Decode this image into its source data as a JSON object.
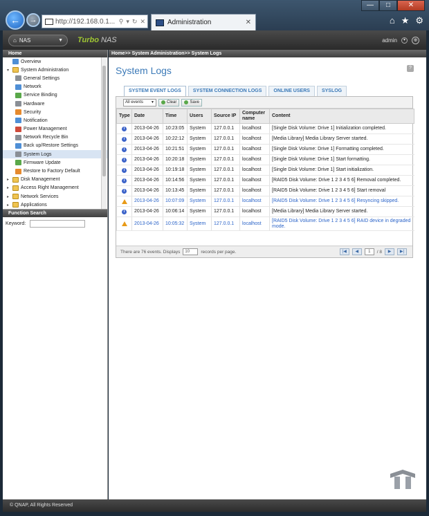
{
  "browser": {
    "address": "http://192.168.0.1...",
    "tab_title": "Administration",
    "window_buttons": [
      "—",
      "□",
      "✕"
    ],
    "tool_icons": [
      "home-icon",
      "star-icon",
      "gear-icon"
    ]
  },
  "header": {
    "nas_label": "NAS",
    "brand_prefix": "Turbo",
    "brand_suffix": "NAS",
    "user": "admin"
  },
  "sidebar": {
    "header": "Home",
    "items": [
      {
        "label": "Overview",
        "level": 0,
        "icon": "blue"
      },
      {
        "label": "System Administration",
        "level": 0,
        "icon": "folder",
        "toggle": "▾"
      },
      {
        "label": "General Settings",
        "level": 1,
        "icon": "gray"
      },
      {
        "label": "Network",
        "level": 1,
        "icon": "blue"
      },
      {
        "label": "Service Binding",
        "level": 1,
        "icon": "green"
      },
      {
        "label": "Hardware",
        "level": 1,
        "icon": "gray"
      },
      {
        "label": "Security",
        "level": 1,
        "icon": "orange"
      },
      {
        "label": "Notification",
        "level": 1,
        "icon": "blue"
      },
      {
        "label": "Power Management",
        "level": 1,
        "icon": "red"
      },
      {
        "label": "Network Recycle Bin",
        "level": 1,
        "icon": "gray"
      },
      {
        "label": "Back up/Restore Settings",
        "level": 1,
        "icon": "blue"
      },
      {
        "label": "System Logs",
        "level": 1,
        "icon": "gray",
        "selected": true
      },
      {
        "label": "Firmware Update",
        "level": 1,
        "icon": "green"
      },
      {
        "label": "Restore to Factory Default",
        "level": 1,
        "icon": "orange"
      },
      {
        "label": "Disk Management",
        "level": 0,
        "icon": "folder",
        "toggle": "▸"
      },
      {
        "label": "Access Right Management",
        "level": 0,
        "icon": "folder",
        "toggle": "▸"
      },
      {
        "label": "Network Services",
        "level": 0,
        "icon": "folder",
        "toggle": "▸"
      },
      {
        "label": "Applications",
        "level": 0,
        "icon": "folder",
        "toggle": "▸"
      }
    ],
    "function_search_title": "Function Search",
    "keyword_label": "Keyword:"
  },
  "main": {
    "breadcrumb": "Home>> System Administration>> System Logs",
    "title": "System Logs",
    "help_label": "?",
    "tabs": [
      "SYSTEM EVENT LOGS",
      "SYSTEM CONNECTION LOGS",
      "ONLINE USERS",
      "SYSLOG"
    ],
    "filter_value": "All events",
    "clear_label": "Clear",
    "save_label": "Save",
    "columns": [
      "Type",
      "Date",
      "Time",
      "Users",
      "Source IP",
      "Computer name",
      "Content"
    ],
    "rows": [
      {
        "type": "info",
        "date": "2013-04-26",
        "time": "10:23:05",
        "user": "System",
        "ip": "127.0.0.1",
        "host": "localhost",
        "content": "[Single Disk Volume: Drive 1] Initialization completed."
      },
      {
        "type": "info",
        "date": "2013-04-26",
        "time": "10:22:12",
        "user": "System",
        "ip": "127.0.0.1",
        "host": "localhost",
        "content": "[Media Library] Media Library Server started."
      },
      {
        "type": "info",
        "date": "2013-04-26",
        "time": "10:21:51",
        "user": "System",
        "ip": "127.0.0.1",
        "host": "localhost",
        "content": "[Single Disk Volume: Drive 1] Formatting completed."
      },
      {
        "type": "info",
        "date": "2013-04-26",
        "time": "10:20:18",
        "user": "System",
        "ip": "127.0.0.1",
        "host": "localhost",
        "content": "[Single Disk Volume: Drive 1] Start formatting."
      },
      {
        "type": "info",
        "date": "2013-04-26",
        "time": "10:19:18",
        "user": "System",
        "ip": "127.0.0.1",
        "host": "localhost",
        "content": "[Single Disk Volume: Drive 1] Start initialization."
      },
      {
        "type": "info",
        "date": "2013-04-26",
        "time": "10:14:56",
        "user": "System",
        "ip": "127.0.0.1",
        "host": "localhost",
        "content": "[RAID5 Disk Volume: Drive 1 2 3 4 5 6] Removal completed."
      },
      {
        "type": "info",
        "date": "2013-04-26",
        "time": "10:13:45",
        "user": "System",
        "ip": "127.0.0.1",
        "host": "localhost",
        "content": "[RAID5 Disk Volume: Drive 1 2 3 4 5 6] Start removal"
      },
      {
        "type": "warn",
        "date": "2013-04-26",
        "time": "10:07:09",
        "user": "System",
        "ip": "127.0.0.1",
        "host": "localhost",
        "content": "[RAID5 Disk Volume: Drive 1 2 3 4 5 6] Resyncing skipped."
      },
      {
        "type": "info",
        "date": "2013-04-26",
        "time": "10:06:14",
        "user": "System",
        "ip": "127.0.0.1",
        "host": "localhost",
        "content": "[Media Library] Media Library Server started."
      },
      {
        "type": "warn",
        "date": "2013-04-26",
        "time": "10:05:32",
        "user": "System",
        "ip": "127.0.0.1",
        "host": "localhost",
        "content": "[RAID5 Disk Volume: Drive 1 2 3 4 5 6] RAID device in degraded mode."
      }
    ],
    "footer_events": "There are 76 events. Displays",
    "per_page": "10",
    "per_page_suffix": "records per page.",
    "page_current": "1",
    "page_total": "/ 8"
  },
  "footer": "© QNAP, All Rights Reserved"
}
